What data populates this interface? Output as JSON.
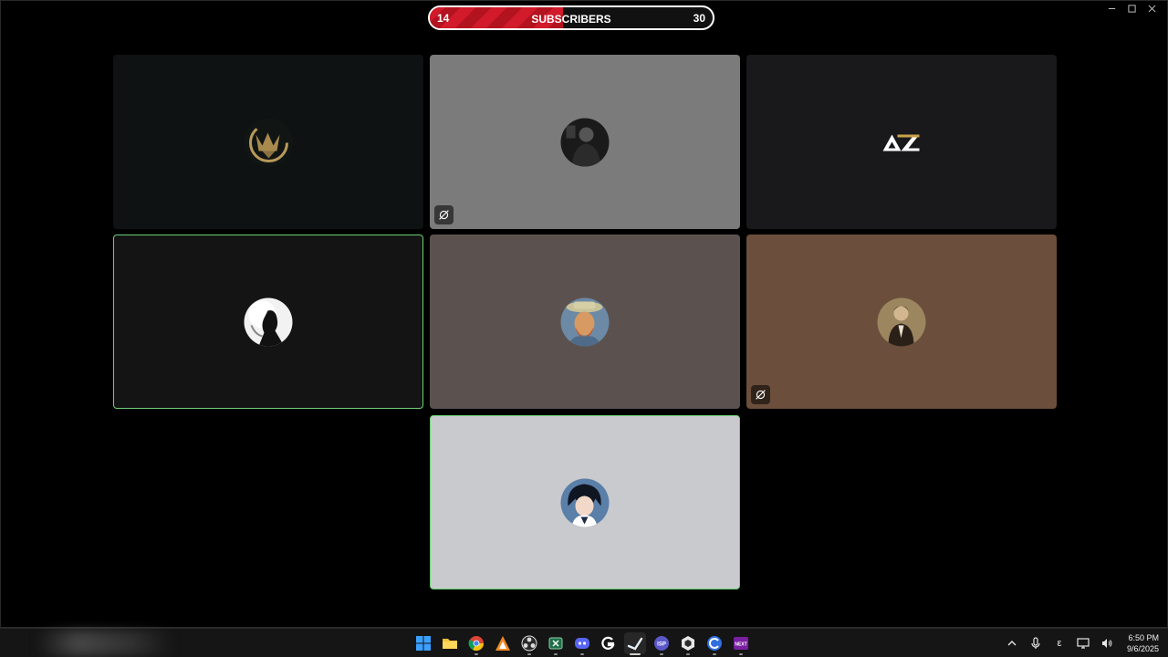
{
  "subscriber_bar": {
    "current": "14",
    "label": "SUBSCRIBERS",
    "goal": "30",
    "progress_fraction": 0.47,
    "fill_color": "#d11a2a"
  },
  "participants": [
    {
      "id": "p1",
      "avatar": "gold-crown-emblem",
      "muted": false,
      "speaking": false,
      "background": "#0f1212"
    },
    {
      "id": "p2",
      "avatar": "dark-portrait",
      "muted": true,
      "speaking": false,
      "background": "#7b7b7b"
    },
    {
      "id": "p3",
      "avatar": "az-logo",
      "avatar_text": "AZ",
      "muted": false,
      "speaking": false,
      "background": "#19191c"
    },
    {
      "id": "p4",
      "avatar": "silhouette-moon",
      "muted": false,
      "speaking": true,
      "background": "#141414"
    },
    {
      "id": "p5",
      "avatar": "van-gogh-portrait",
      "muted": false,
      "speaking": false,
      "background": "#5b5250"
    },
    {
      "id": "p6",
      "avatar": "vintage-portrait",
      "muted": true,
      "speaking": false,
      "background": "#6b4e3b"
    },
    {
      "id": "p7",
      "avatar": "anime-character",
      "muted": false,
      "speaking": true,
      "background": "#c9cace"
    }
  ],
  "taskbar": {
    "apps": [
      {
        "name": "windows-start-icon"
      },
      {
        "name": "file-explorer-icon"
      },
      {
        "name": "chrome-icon"
      },
      {
        "name": "aimp-icon"
      },
      {
        "name": "obs-icon"
      },
      {
        "name": "excel-icon"
      },
      {
        "name": "discord-icon"
      },
      {
        "name": "logitech-icon"
      },
      {
        "name": "steam-icon",
        "active": true
      },
      {
        "name": "isp-icon"
      },
      {
        "name": "unity-icon"
      },
      {
        "name": "cursor-icon"
      },
      {
        "name": "next-icon",
        "label": "NEXT"
      }
    ],
    "tray": {
      "language": "ε",
      "time": "6:50 PM",
      "date": "9/6/2025"
    }
  }
}
